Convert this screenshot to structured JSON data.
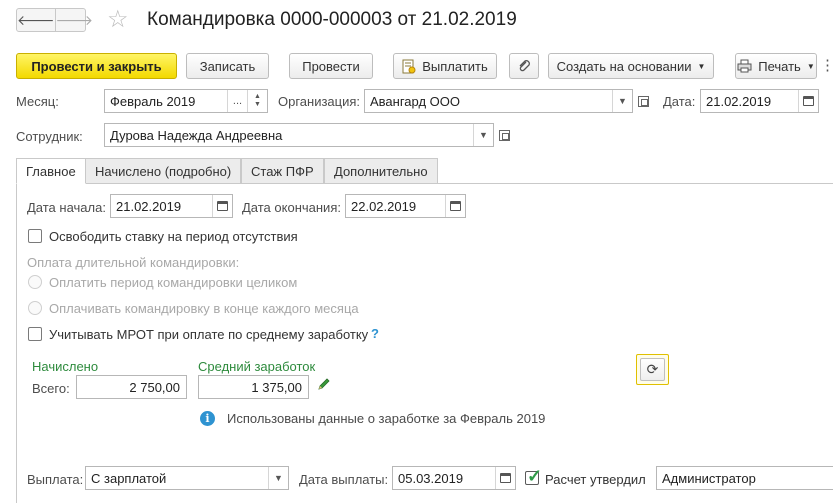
{
  "header": {
    "back_icon": "arrow-left-icon",
    "forward_icon": "arrow-right-icon",
    "favorite_icon": "star-icon",
    "title": "Командировка 0000-000003 от 21.02.2019"
  },
  "toolbar": {
    "post_close": "Провести и закрыть",
    "save": "Записать",
    "post": "Провести",
    "pay": "Выплатить",
    "attach_icon": "paperclip-icon",
    "create_based": "Создать на основании",
    "print": "Печать",
    "more": "⋮"
  },
  "form": {
    "month_label": "Месяц:",
    "month_value": "Февраль 2019",
    "month_select": "...",
    "org_label": "Организация:",
    "org_value": "Авангард ООО",
    "date_label": "Дата:",
    "date_value": "21.02.2019",
    "employee_label": "Сотрудник:",
    "employee_value": "Дурова Надежда Андреевна"
  },
  "tabs": [
    {
      "label": "Главное",
      "active": true
    },
    {
      "label": "Начислено (подробно)"
    },
    {
      "label": "Стаж ПФР"
    },
    {
      "label": "Дополнительно"
    }
  ],
  "main": {
    "start_label": "Дата начала:",
    "start_value": "21.02.2019",
    "end_label": "Дата окончания:",
    "end_value": "22.02.2019",
    "release_rate_label": "Освободить ставку на период отсутствия",
    "long_trip_label": "Оплата длительной командировки:",
    "pay_whole_label": "Оплатить период командировки целиком",
    "pay_monthly_label": "Оплачивать командировку в конце каждого месяца",
    "mrot_label": "Учитывать МРОТ при оплате по среднему заработку",
    "help_mark": "?",
    "accrued_header": "Начислено",
    "avg_header": "Средний заработок",
    "total_label": "Всего:",
    "total_value": "2 750,00",
    "avg_value": "1 375,00",
    "info_text": "Использованы данные о заработке за Февраль 2019"
  },
  "payment": {
    "label": "Выплата:",
    "value": "С зарплатой",
    "date_label": "Дата выплаты:",
    "date_value": "05.03.2019",
    "approved_label": "Расчет утвердил",
    "approved_checked": true,
    "approver_value": "Администратор"
  }
}
